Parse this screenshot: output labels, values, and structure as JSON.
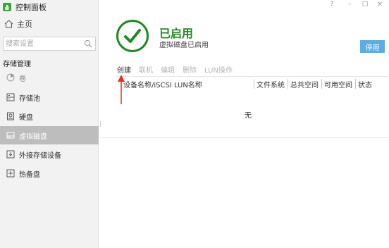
{
  "app": {
    "title": "控制面板",
    "window_controls": [
      "?",
      "–",
      "□",
      "×"
    ]
  },
  "sidebar": {
    "home_label": "主页",
    "search_placeholder": "搜索设置",
    "section_title": "存储管理",
    "items": [
      {
        "label": "卷",
        "icon": "volume-icon",
        "state": "disabled"
      },
      {
        "label": "存储池",
        "icon": "storage-pool-icon",
        "state": "normal"
      },
      {
        "label": "硬盘",
        "icon": "hard-disk-icon",
        "state": "normal"
      },
      {
        "label": "虚拟磁盘",
        "icon": "virtual-disk-icon",
        "state": "active"
      },
      {
        "label": "外接存储设备",
        "icon": "external-storage-icon",
        "state": "normal"
      },
      {
        "label": "热备盘",
        "icon": "hot-spare-icon",
        "state": "normal"
      }
    ]
  },
  "status": {
    "title": "已启用",
    "subtitle": "虚拟磁盘已启用",
    "button_label": "停用",
    "accent_color": "#1f8a1f",
    "button_color": "#5aaee3"
  },
  "toolbar": {
    "buttons": [
      {
        "label": "创建",
        "enabled": true
      },
      {
        "label": "联机",
        "enabled": false
      },
      {
        "label": "编辑",
        "enabled": false
      },
      {
        "label": "删除",
        "enabled": false
      },
      {
        "label": "LUN操作",
        "enabled": false
      }
    ]
  },
  "table": {
    "columns": [
      "设备名称/iSCSI LUN名称",
      "文件系统",
      "总共空间",
      "可用空间",
      "状态"
    ],
    "empty_text": "无"
  },
  "annotation": {
    "arrow_color": "#e0302a"
  }
}
